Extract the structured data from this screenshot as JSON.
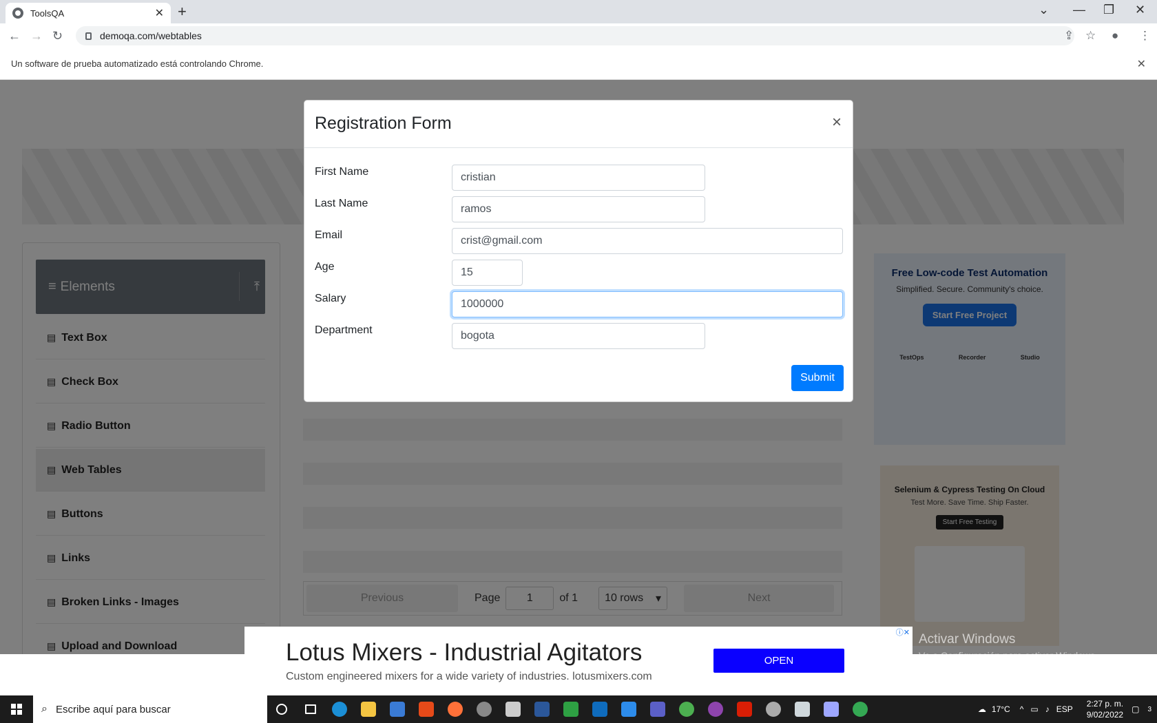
{
  "browser": {
    "tab_title": "ToolsQA",
    "url": "demoqa.com/webtables",
    "infobar_text": "Un software de prueba automatizado está controlando Chrome."
  },
  "sidebar": {
    "group_label": "Elements",
    "items": [
      {
        "label": "Text Box",
        "active": false
      },
      {
        "label": "Check Box",
        "active": false
      },
      {
        "label": "Radio Button",
        "active": false
      },
      {
        "label": "Web Tables",
        "active": true
      },
      {
        "label": "Buttons",
        "active": false
      },
      {
        "label": "Links",
        "active": false
      },
      {
        "label": "Broken Links - Images",
        "active": false
      },
      {
        "label": "Upload and Download",
        "active": false
      }
    ]
  },
  "pagination": {
    "previous_label": "Previous",
    "page_label": "Page",
    "page_value": "1",
    "of_label": "of 1",
    "rows_label": "10 rows",
    "next_label": "Next"
  },
  "modal": {
    "title": "Registration Form",
    "close_glyph": "×",
    "fields": {
      "first_name": {
        "label": "First Name",
        "value": "cristian"
      },
      "last_name": {
        "label": "Last Name",
        "value": "ramos"
      },
      "email": {
        "label": "Email",
        "value": "crist@gmail.com"
      },
      "age": {
        "label": "Age",
        "value": "15"
      },
      "salary": {
        "label": "Salary",
        "value": "1000000"
      },
      "department": {
        "label": "Department",
        "value": "bogota"
      }
    },
    "submit_label": "Submit"
  },
  "ads": {
    "right1": {
      "title": "Free Low-code Test Automation",
      "subtitle": "Simplified. Secure. Community's choice.",
      "button": "Start Free Project",
      "labels": [
        "TestOps",
        "Recorder",
        "Studio"
      ]
    },
    "right2": {
      "title": "Selenium & Cypress Testing On Cloud",
      "subtitle": "Test More. Save Time. Ship Faster.",
      "button": "Start Free Testing"
    },
    "bottom": {
      "headline": "Lotus Mixers - Industrial Agitators",
      "subline": "Custom engineered mixers for a wide variety of industries. lotusmixers.com",
      "button": "OPEN"
    }
  },
  "watermark": {
    "line1": "Activar Windows",
    "line2": "Ve a Configuración para activar Windows."
  },
  "taskbar": {
    "search_placeholder": "Escribe aquí para buscar",
    "temperature": "17°C",
    "language": "ESP",
    "time": "2:27 p. m.",
    "date": "9/02/2022",
    "notification_count": "3"
  },
  "colors": {
    "accent": "#007bff",
    "sidebar_header": "#6c757d",
    "ad_open": "#0a00ff"
  }
}
